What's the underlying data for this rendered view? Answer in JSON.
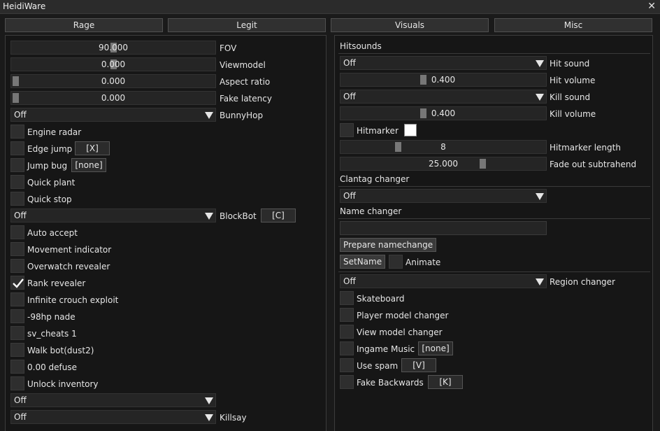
{
  "window": {
    "title": "HeidiWare",
    "close_glyph": "✕"
  },
  "tabs": [
    "Rage",
    "Legit",
    "Visuals",
    "Misc"
  ],
  "left": {
    "sliders": [
      {
        "value": "90.000",
        "label": "FOV",
        "fraction": 0.5
      },
      {
        "value": "0.000",
        "label": "Viewmodel",
        "fraction": 0.5
      },
      {
        "value": "0.000",
        "label": "Aspect ratio",
        "fraction": 0.0
      },
      {
        "value": "0.000",
        "label": "Fake latency",
        "fraction": 0.0
      }
    ],
    "bunnyhop": {
      "selected": "Off",
      "label": "BunnyHop"
    },
    "checks_a": [
      {
        "label": "Engine radar",
        "checked": false
      },
      {
        "label": "Edge jump",
        "checked": false,
        "key": "[X]"
      },
      {
        "label": "Jump bug",
        "checked": false,
        "key": "[none]"
      },
      {
        "label": "Quick plant",
        "checked": false
      },
      {
        "label": "Quick stop",
        "checked": false
      }
    ],
    "blockbot": {
      "selected": "Off",
      "label": "BlockBot",
      "key": "[C]"
    },
    "checks_b": [
      {
        "label": "Auto accept",
        "checked": false
      },
      {
        "label": "Movement indicator",
        "checked": false
      },
      {
        "label": "Overwatch revealer",
        "checked": false
      },
      {
        "label": "Rank revealer",
        "checked": true
      },
      {
        "label": "Infinite crouch exploit",
        "checked": false
      },
      {
        "label": "-98hp nade",
        "checked": false
      },
      {
        "label": "sv_cheats 1",
        "checked": false
      },
      {
        "label": "Walk bot(dust2)",
        "checked": false
      },
      {
        "label": "0.00 defuse",
        "checked": false
      },
      {
        "label": "Unlock inventory",
        "checked": false
      }
    ],
    "combo_extra": {
      "selected": "Off"
    },
    "killsay": {
      "selected": "Off",
      "label": "Killsay"
    }
  },
  "right": {
    "hitsounds_header": "Hitsounds",
    "hit_sound": {
      "selected": "Off",
      "label": "Hit sound"
    },
    "hit_volume": {
      "value": "0.400",
      "label": "Hit volume",
      "fraction": 0.4
    },
    "kill_sound": {
      "selected": "Off",
      "label": "Kill sound"
    },
    "kill_volume": {
      "value": "0.400",
      "label": "Kill volume",
      "fraction": 0.4
    },
    "hitmarker": {
      "label": "Hitmarker",
      "checked": false,
      "color": "#ffffff"
    },
    "hitmarker_length": {
      "value": "8",
      "label": "Hitmarker length",
      "fraction": 0.27
    },
    "fade_out": {
      "value": "25.000",
      "label": "Fade out subtrahend",
      "fraction": 0.7
    },
    "clantag_header": "Clantag changer",
    "clantag": {
      "selected": "Off"
    },
    "name_header": "Name changer",
    "name_input": {
      "value": ""
    },
    "prepare_button": "Prepare namechange",
    "setname_button": "SetName",
    "animate": {
      "label": "Animate",
      "checked": false
    },
    "region": {
      "selected": "Off",
      "label": "Region changer"
    },
    "checks": [
      {
        "label": "Skateboard",
        "checked": false
      },
      {
        "label": "Player model changer",
        "checked": false
      },
      {
        "label": "View model changer",
        "checked": false
      },
      {
        "label": "Ingame Music",
        "checked": false,
        "key": "[none]"
      },
      {
        "label": "Use spam",
        "checked": false,
        "key": "[V]"
      },
      {
        "label": "Fake Backwards",
        "checked": false,
        "key": "[K]"
      }
    ]
  },
  "colors": {
    "background": "#1a1a1a",
    "panel": "#161616",
    "control": "#252525",
    "knob": "#777777"
  }
}
